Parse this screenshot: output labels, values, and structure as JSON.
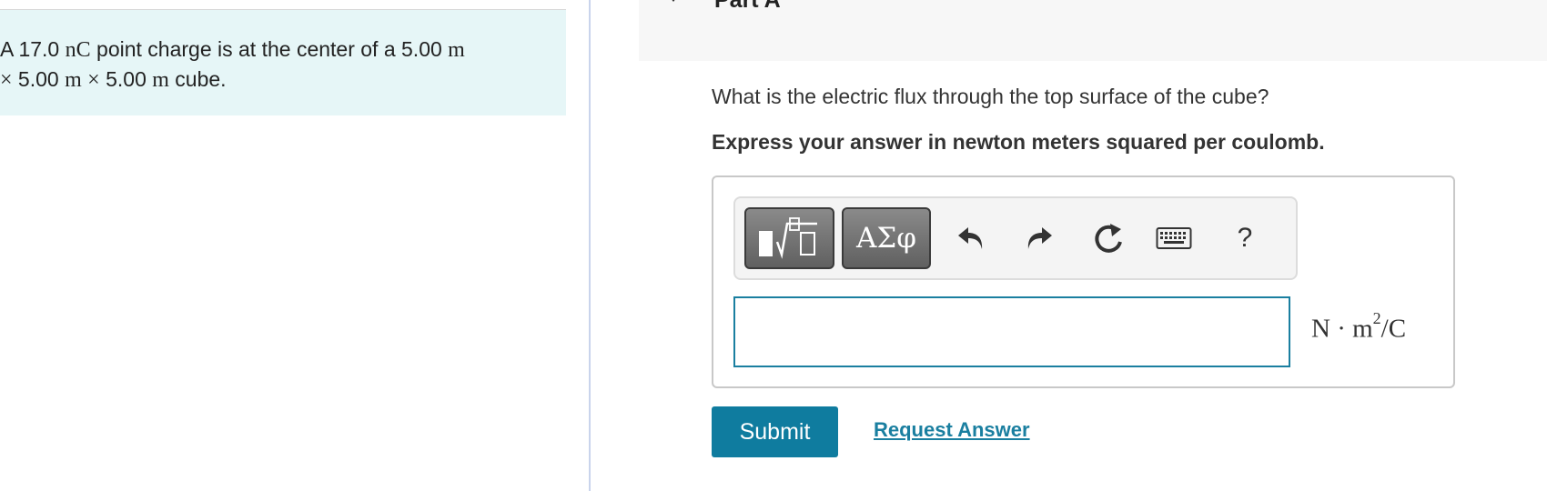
{
  "problem": {
    "text_1": "A 17.0 ",
    "math_1": "nC",
    "text_2": " point charge is at the center of a 5.00 ",
    "math_2": "m",
    "line2_math_1": "×",
    "line2_text_1": " 5.00 ",
    "line2_math_2": "m",
    "line2_text_2": " ",
    "line2_math_3": "×",
    "line2_text_3": "  5.00 ",
    "line2_math_4": "m",
    "line2_text_4": " cube."
  },
  "part": {
    "title": "Part A"
  },
  "question": {
    "prompt": "What is the electric flux through the top surface of the cube?",
    "instruction": "Express your answer in newton meters squared per coulomb."
  },
  "toolbar": {
    "greek_label": "ΑΣφ",
    "help_label": "?",
    "icons": [
      "templates-icon",
      "greek-letters-icon",
      "undo-icon",
      "redo-icon",
      "reset-icon",
      "keyboard-icon",
      "help-icon"
    ]
  },
  "answer": {
    "value": "",
    "units_base": "N · m",
    "units_exp": "2",
    "units_tail": "/C"
  },
  "actions": {
    "submit_label": "Submit",
    "request_label": "Request Answer"
  },
  "colors": {
    "accent": "#0f7c9f",
    "problem_bg": "#e6f6f7",
    "link": "#1a7fa0"
  }
}
